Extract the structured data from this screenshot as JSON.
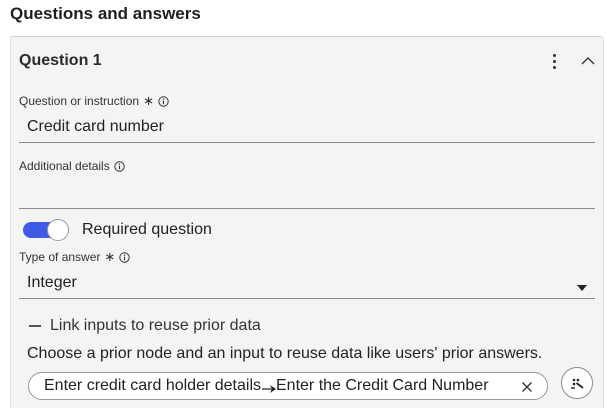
{
  "section": {
    "title": "Questions and answers"
  },
  "question": {
    "title": "Question 1",
    "menu_icon": "kebab-menu-icon",
    "collapse_icon": "chevron-up-icon",
    "instruction": {
      "label": "Question or instruction",
      "required_mark": "∗",
      "value": "Credit card number"
    },
    "details": {
      "label": "Additional details",
      "value": ""
    },
    "required": {
      "label": "Required question",
      "enabled": true
    },
    "answer_type": {
      "label": "Type of answer",
      "required_mark": "∗",
      "value": "Integer"
    },
    "link_inputs": {
      "label": "Link inputs to reuse prior data",
      "helper": "Choose a prior node and an input to reuse data like users' prior answers.",
      "chip": {
        "node": "Enter credit card holder details",
        "input": "Enter the Credit Card Number"
      }
    }
  },
  "colors": {
    "toggle_on": "#3f5be6",
    "card_bg": "#f3f4f4"
  }
}
